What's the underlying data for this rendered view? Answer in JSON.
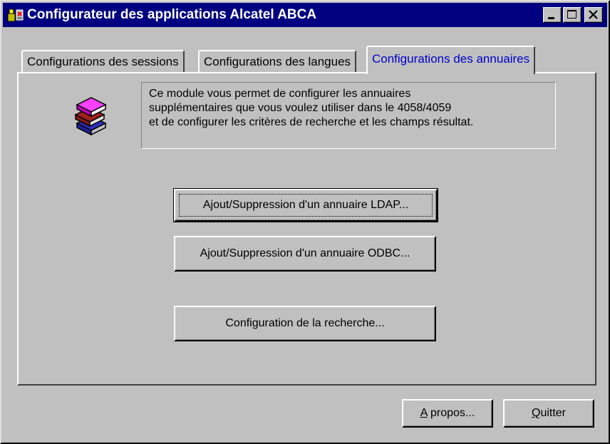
{
  "window": {
    "title": "Configurateur des applications Alcatel ABCA"
  },
  "tabs": [
    {
      "label": "Configurations des sessions",
      "active": false
    },
    {
      "label": "Configurations des langues",
      "active": false
    },
    {
      "label": "Configurations des annuaires",
      "active": true
    }
  ],
  "panel": {
    "info_lines": [
      "Ce module vous permet de configurer les annuaires",
      "supplémentaires que vous voulez utiliser dans le 4058/4059",
      "et de configurer les critères de recherche et les champs résultat."
    ],
    "icon": "books-icon",
    "buttons": {
      "ldap": "Ajout/Suppression d'un annuaire LDAP...",
      "odbc": "Ajout/Suppression d'un annuaire ODBC...",
      "search": "Configuration de la recherche..."
    }
  },
  "footer": {
    "about_first": "A",
    "about_rest": " propos...",
    "quit_first": "Q",
    "quit_rest": "uitter"
  },
  "colors": {
    "titlebar": "#000080",
    "active_tab_text": "#0000c8",
    "face": "#c0c0c0"
  }
}
